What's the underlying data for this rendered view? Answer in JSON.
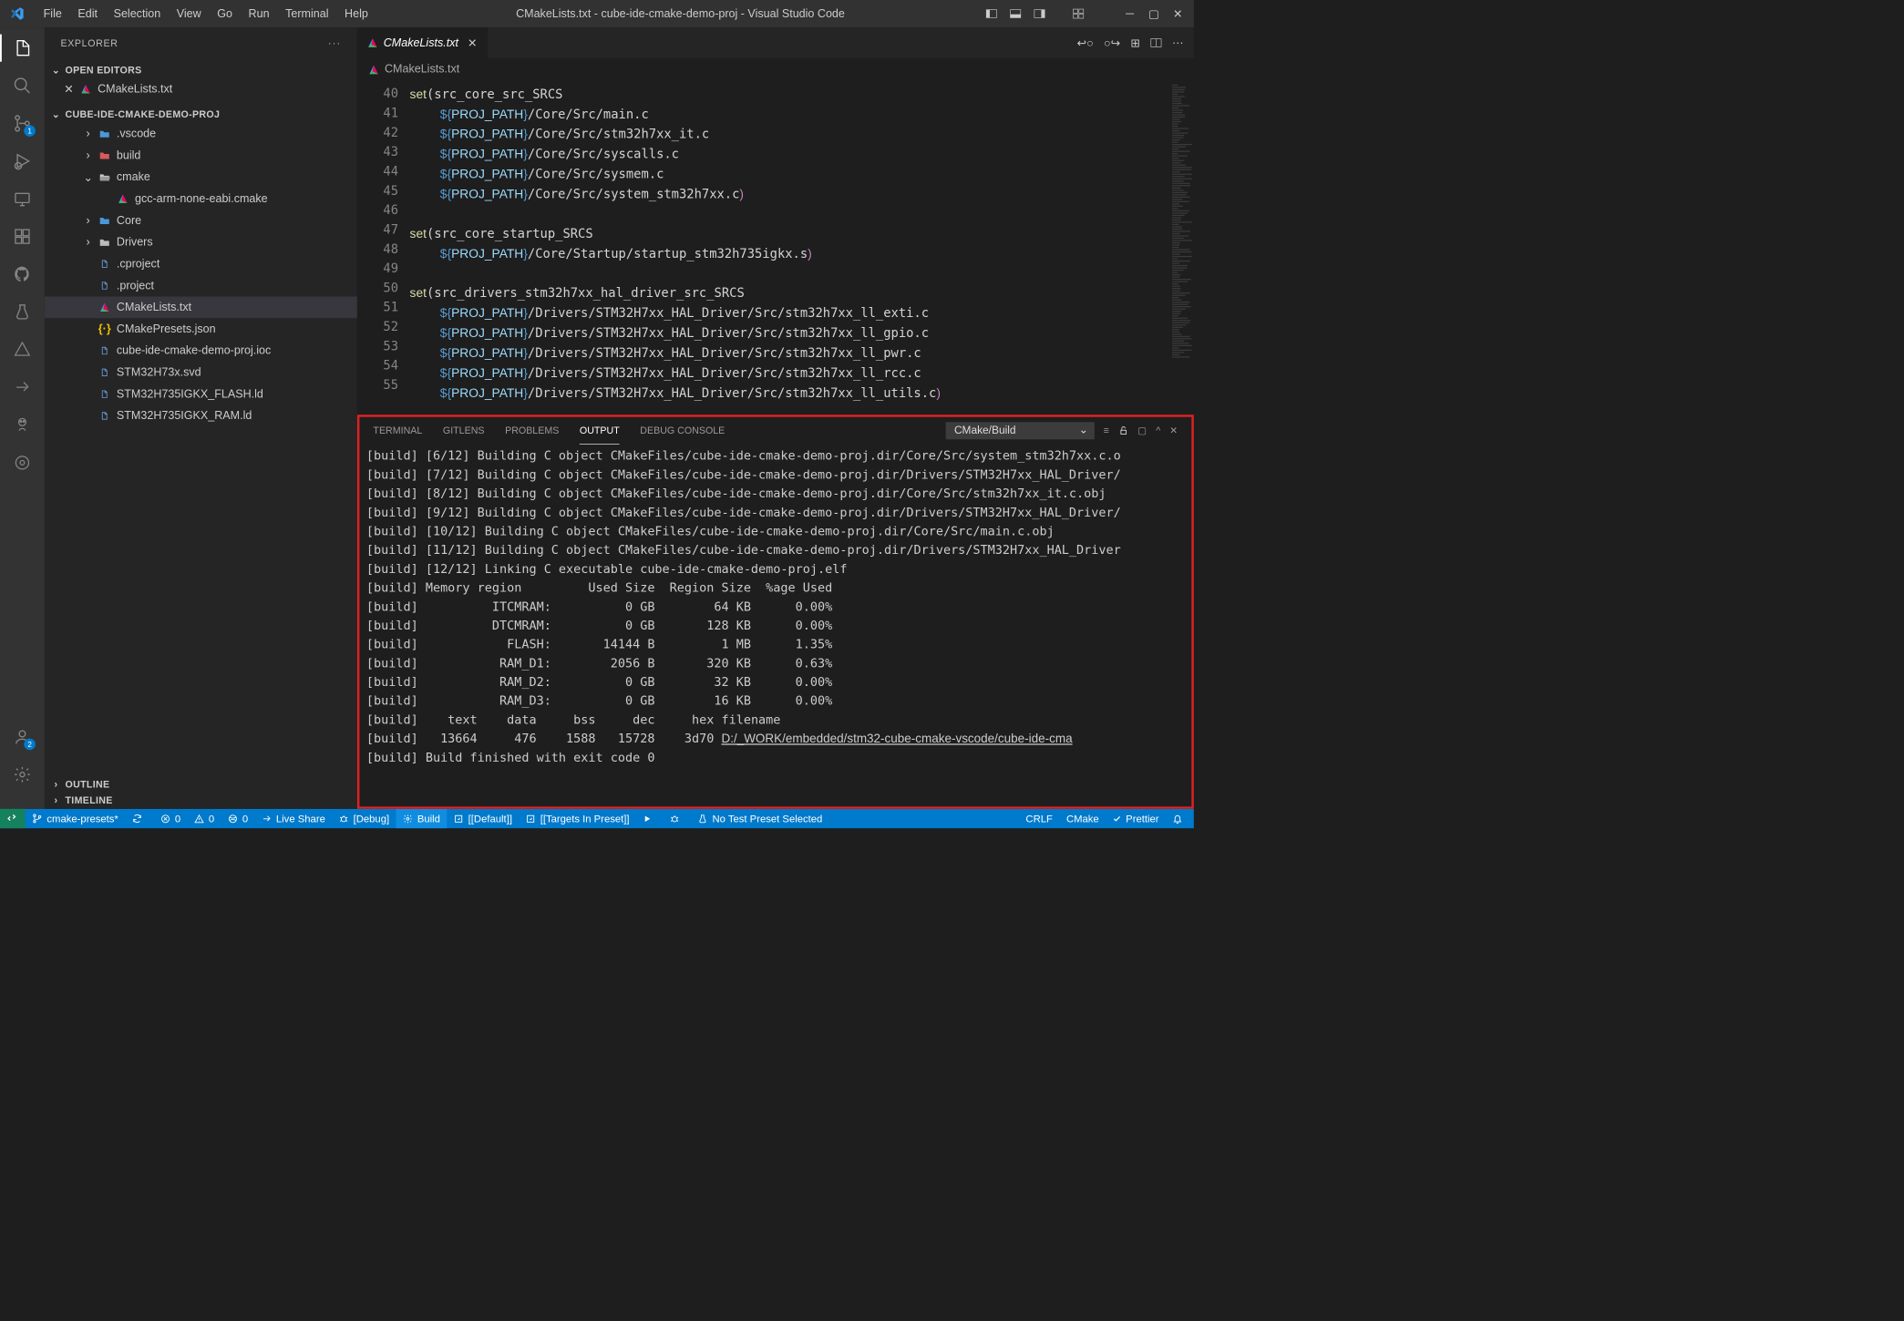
{
  "title": "CMakeLists.txt - cube-ide-cmake-demo-proj - Visual Studio Code",
  "menu": [
    "File",
    "Edit",
    "Selection",
    "View",
    "Go",
    "Run",
    "Terminal",
    "Help"
  ],
  "explorer_label": "EXPLORER",
  "open_editors_label": "OPEN EDITORS",
  "open_editors": [
    {
      "name": "CMakeLists.txt"
    }
  ],
  "folder_root": "CUBE-IDE-CMAKE-DEMO-PROJ",
  "tree": [
    {
      "type": "folder",
      "name": ".vscode",
      "depth": 2,
      "expanded": false,
      "icon": "folder-blue"
    },
    {
      "type": "folder",
      "name": "build",
      "depth": 2,
      "expanded": false,
      "icon": "folder-red"
    },
    {
      "type": "folder",
      "name": "cmake",
      "depth": 2,
      "expanded": true,
      "icon": "folder-open"
    },
    {
      "type": "file",
      "name": "gcc-arm-none-eabi.cmake",
      "depth": 3,
      "icon": "cmake"
    },
    {
      "type": "folder",
      "name": "Core",
      "depth": 2,
      "expanded": false,
      "icon": "folder-blue"
    },
    {
      "type": "folder",
      "name": "Drivers",
      "depth": 2,
      "expanded": false,
      "icon": "folder-grey"
    },
    {
      "type": "file",
      "name": ".cproject",
      "depth": 2,
      "icon": "file"
    },
    {
      "type": "file",
      "name": ".project",
      "depth": 2,
      "icon": "file"
    },
    {
      "type": "file",
      "name": "CMakeLists.txt",
      "depth": 2,
      "icon": "cmake",
      "selected": true
    },
    {
      "type": "file",
      "name": "CMakePresets.json",
      "depth": 2,
      "icon": "json"
    },
    {
      "type": "file",
      "name": "cube-ide-cmake-demo-proj.ioc",
      "depth": 2,
      "icon": "file"
    },
    {
      "type": "file",
      "name": "STM32H73x.svd",
      "depth": 2,
      "icon": "file"
    },
    {
      "type": "file",
      "name": "STM32H735IGKX_FLASH.ld",
      "depth": 2,
      "icon": "file"
    },
    {
      "type": "file",
      "name": "STM32H735IGKX_RAM.ld",
      "depth": 2,
      "icon": "file"
    }
  ],
  "outline_label": "OUTLINE",
  "timeline_label": "TIMELINE",
  "tab": {
    "name": "CMakeLists.txt"
  },
  "breadcrumb": "CMakeLists.txt",
  "code_lines": [
    {
      "n": 40,
      "html": "<span class='kw-set'>set</span>(src_core_src_SRCS"
    },
    {
      "n": 41,
      "html": "    <span class='dol'>${</span><span class='var'>PROJ_PATH</span><span class='dol'>}</span>/Core/Src/main.c"
    },
    {
      "n": 42,
      "html": "    <span class='dol'>${</span><span class='var'>PROJ_PATH</span><span class='dol'>}</span>/Core/Src/stm32h7xx_it.c"
    },
    {
      "n": 43,
      "html": "    <span class='dol'>${</span><span class='var'>PROJ_PATH</span><span class='dol'>}</span>/Core/Src/syscalls.c"
    },
    {
      "n": 44,
      "html": "    <span class='dol'>${</span><span class='var'>PROJ_PATH</span><span class='dol'>}</span>/Core/Src/sysmem.c"
    },
    {
      "n": 45,
      "html": "    <span class='dol'>${</span><span class='var'>PROJ_PATH</span><span class='dol'>}</span>/Core/Src/system_stm32h7xx.c<span class='br'>)</span>"
    },
    {
      "n": 46,
      "html": ""
    },
    {
      "n": 47,
      "html": "<span class='kw-set'>set</span>(src_core_startup_SRCS"
    },
    {
      "n": 48,
      "html": "    <span class='dol'>${</span><span class='var'>PROJ_PATH</span><span class='dol'>}</span>/Core/Startup/startup_stm32h735igkx.s<span class='br'>)</span>"
    },
    {
      "n": 49,
      "html": ""
    },
    {
      "n": 50,
      "html": "<span class='kw-set'>set</span>(src_drivers_stm32h7xx_hal_driver_src_SRCS"
    },
    {
      "n": 51,
      "html": "    <span class='dol'>${</span><span class='var'>PROJ_PATH</span><span class='dol'>}</span>/Drivers/STM32H7xx_HAL_Driver/Src/stm32h7xx_ll_exti.c"
    },
    {
      "n": 52,
      "html": "    <span class='dol'>${</span><span class='var'>PROJ_PATH</span><span class='dol'>}</span>/Drivers/STM32H7xx_HAL_Driver/Src/stm32h7xx_ll_gpio.c"
    },
    {
      "n": 53,
      "html": "    <span class='dol'>${</span><span class='var'>PROJ_PATH</span><span class='dol'>}</span>/Drivers/STM32H7xx_HAL_Driver/Src/stm32h7xx_ll_pwr.c"
    },
    {
      "n": 54,
      "html": "    <span class='dol'>${</span><span class='var'>PROJ_PATH</span><span class='dol'>}</span>/Drivers/STM32H7xx_HAL_Driver/Src/stm32h7xx_ll_rcc.c"
    },
    {
      "n": 55,
      "html": "    <span class='dol'>${</span><span class='var'>PROJ_PATH</span><span class='dol'>}</span>/Drivers/STM32H7xx_HAL_Driver/Src/stm32h7xx_ll_utils.c<span class='br'>)</span>"
    }
  ],
  "panel_tabs": [
    "TERMINAL",
    "GITLENS",
    "PROBLEMS",
    "OUTPUT",
    "DEBUG CONSOLE"
  ],
  "panel_active": "OUTPUT",
  "output_selector": "CMake/Build",
  "output_lines": [
    "[build] [6/12] Building C object CMakeFiles/cube-ide-cmake-demo-proj.dir/Core/Src/system_stm32h7xx.c.o",
    "[build] [7/12] Building C object CMakeFiles/cube-ide-cmake-demo-proj.dir/Drivers/STM32H7xx_HAL_Driver/",
    "[build] [8/12] Building C object CMakeFiles/cube-ide-cmake-demo-proj.dir/Core/Src/stm32h7xx_it.c.obj",
    "[build] [9/12] Building C object CMakeFiles/cube-ide-cmake-demo-proj.dir/Drivers/STM32H7xx_HAL_Driver/",
    "[build] [10/12] Building C object CMakeFiles/cube-ide-cmake-demo-proj.dir/Core/Src/main.c.obj",
    "[build] [11/12] Building C object CMakeFiles/cube-ide-cmake-demo-proj.dir/Drivers/STM32H7xx_HAL_Driver",
    "[build] [12/12] Linking C executable cube-ide-cmake-demo-proj.elf",
    "[build] Memory region         Used Size  Region Size  %age Used",
    "[build]          ITCMRAM:          0 GB        64 KB      0.00%",
    "[build]          DTCMRAM:          0 GB       128 KB      0.00%",
    "[build]            FLASH:       14144 B         1 MB      1.35%",
    "[build]           RAM_D1:        2056 B       320 KB      0.63%",
    "[build]           RAM_D2:          0 GB        32 KB      0.00%",
    "[build]           RAM_D3:          0 GB        16 KB      0.00%",
    "[build]    text\t   data\t    bss\t    dec\t    hex\tfilename",
    "[build]   13664\t    476\t   1588\t  15728\t   3d70\t<span class='link'>D:/_WORK/embedded/stm32-cube-cmake-vscode/cube-ide-cma</span>",
    "[build] Build finished with exit code 0",
    ""
  ],
  "status_left": [
    {
      "icon": "remote",
      "text": ""
    },
    {
      "icon": "branch",
      "text": "cmake-presets*"
    },
    {
      "icon": "sync",
      "text": ""
    },
    {
      "icon": "err",
      "text": "0"
    },
    {
      "icon": "warn",
      "text": "0"
    },
    {
      "icon": "port",
      "text": "0"
    },
    {
      "icon": "live",
      "text": "Live Share"
    },
    {
      "icon": "bug",
      "text": "[Debug]"
    },
    {
      "icon": "gear",
      "text": "Build",
      "build": true
    },
    {
      "icon": "target",
      "text": "[[Default]]"
    },
    {
      "icon": "target",
      "text": "[[Targets In Preset]]"
    },
    {
      "icon": "play",
      "text": ""
    },
    {
      "icon": "bug2",
      "text": ""
    },
    {
      "icon": "beaker",
      "text": "No Test Preset Selected"
    }
  ],
  "status_right": [
    {
      "text": "CRLF"
    },
    {
      "text": "CMake"
    },
    {
      "icon": "check",
      "text": "Prettier"
    },
    {
      "icon": "bell",
      "text": ""
    }
  ],
  "activity_badges": {
    "scm": "1",
    "account": "2"
  }
}
